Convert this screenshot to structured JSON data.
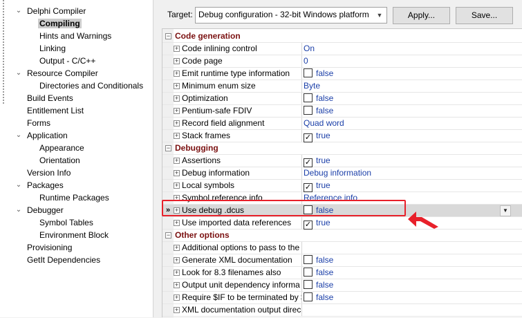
{
  "tree": {
    "items": [
      {
        "label": "Delphi Compiler",
        "level": 0,
        "expander": "collapse"
      },
      {
        "label": "Compiling",
        "level": 1,
        "selected": true
      },
      {
        "label": "Hints and Warnings",
        "level": 1
      },
      {
        "label": "Linking",
        "level": 1
      },
      {
        "label": "Output - C/C++",
        "level": 1
      },
      {
        "label": "Resource Compiler",
        "level": 0,
        "expander": "collapse"
      },
      {
        "label": "Directories and Conditionals",
        "level": 1
      },
      {
        "label": "Build Events",
        "level": 0
      },
      {
        "label": "Entitlement List",
        "level": 0
      },
      {
        "label": "Forms",
        "level": 0
      },
      {
        "label": "Application",
        "level": 0,
        "expander": "collapse"
      },
      {
        "label": "Appearance",
        "level": 1
      },
      {
        "label": "Orientation",
        "level": 1
      },
      {
        "label": "Version Info",
        "level": 0
      },
      {
        "label": "Packages",
        "level": 0,
        "expander": "collapse"
      },
      {
        "label": "Runtime Packages",
        "level": 1
      },
      {
        "label": "Debugger",
        "level": 0,
        "expander": "collapse"
      },
      {
        "label": "Symbol Tables",
        "level": 1
      },
      {
        "label": "Environment Block",
        "level": 1
      },
      {
        "label": "Provisioning",
        "level": 0
      },
      {
        "label": "GetIt Dependencies",
        "level": 0
      }
    ]
  },
  "toolbar": {
    "target_label": "Target:",
    "target_value": "Debug configuration - 32-bit Windows platform",
    "apply_label": "Apply...",
    "save_label": "Save..."
  },
  "grid": {
    "rows": [
      {
        "type": "category",
        "title": "Code generation"
      },
      {
        "type": "prop",
        "name": "Code inlining control",
        "value": "On"
      },
      {
        "type": "prop",
        "name": "Code page",
        "value": "0"
      },
      {
        "type": "prop",
        "name": "Emit runtime type information",
        "checkbox": false,
        "value": "false"
      },
      {
        "type": "prop",
        "name": "Minimum enum size",
        "value": "Byte"
      },
      {
        "type": "prop",
        "name": "Optimization",
        "checkbox": false,
        "value": "false"
      },
      {
        "type": "prop",
        "name": "Pentium-safe FDIV",
        "checkbox": false,
        "value": "false"
      },
      {
        "type": "prop",
        "name": "Record field alignment",
        "value": "Quad word"
      },
      {
        "type": "prop",
        "name": "Stack frames",
        "checkbox": true,
        "value": "true"
      },
      {
        "type": "category",
        "title": "Debugging"
      },
      {
        "type": "prop",
        "name": "Assertions",
        "checkbox": true,
        "value": "true"
      },
      {
        "type": "prop",
        "name": "Debug information",
        "value": "Debug information"
      },
      {
        "type": "prop",
        "name": "Local symbols",
        "checkbox": true,
        "value": "true"
      },
      {
        "type": "prop",
        "name": "Symbol reference info",
        "value": "Reference info"
      },
      {
        "type": "prop",
        "name": "Use debug .dcus",
        "checkbox": false,
        "value": "false",
        "selected": true
      },
      {
        "type": "prop",
        "name": "Use imported data references",
        "checkbox": true,
        "value": "true"
      },
      {
        "type": "category",
        "title": "Other options"
      },
      {
        "type": "prop",
        "name": "Additional options to pass to the",
        "value": ""
      },
      {
        "type": "prop",
        "name": "Generate XML documentation",
        "checkbox": false,
        "value": "false"
      },
      {
        "type": "prop",
        "name": "Look for 8.3 filenames also",
        "checkbox": false,
        "value": "false"
      },
      {
        "type": "prop",
        "name": "Output unit dependency informa",
        "checkbox": false,
        "value": "false"
      },
      {
        "type": "prop",
        "name": "Require $IF to be terminated by $",
        "checkbox": false,
        "value": "false"
      },
      {
        "type": "prop",
        "name": "XML documentation output direc",
        "value": ""
      }
    ],
    "selected_marker": "»",
    "dropdown_icon": "chevron-down-icon"
  },
  "colors": {
    "category_title": "#7a1010",
    "value_text": "#1b3fa8",
    "highlight": "#e8202a"
  }
}
